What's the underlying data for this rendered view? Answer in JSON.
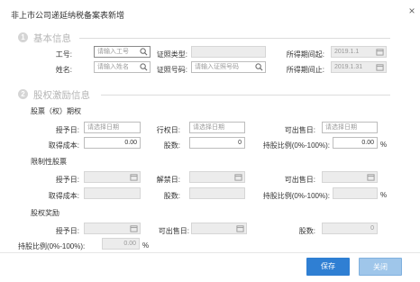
{
  "dialog": {
    "title": "非上市公司递延纳税备案表新增",
    "close_symbol": "×"
  },
  "sections": {
    "basic": {
      "number": "1",
      "title": "基本信息"
    },
    "equity": {
      "number": "2",
      "title": "股权激励信息"
    }
  },
  "basic": {
    "employee_id_label": "工号:",
    "employee_id_placeholder": "请输入工号",
    "cert_type_label": "证照类型:",
    "period_start_label": "所得期间起:",
    "period_start_value": "2019.1.1",
    "name_label": "姓名:",
    "name_placeholder": "请输入姓名",
    "cert_no_label": "证照号码:",
    "cert_no_placeholder": "请输入证照号码",
    "period_end_label": "所得期间止:",
    "period_end_value": "2019.1.31"
  },
  "stock_option": {
    "title": "股票（权）期权",
    "grant_date_label": "授予日:",
    "grant_date_placeholder": "请选择日期",
    "exercise_date_label": "行权日:",
    "exercise_date_placeholder": "请选择日期",
    "sellable_date_label": "可出售日:",
    "sellable_date_placeholder": "请选择日期",
    "cost_label": "取得成本:",
    "cost_value": "0.00",
    "shares_label": "股数:",
    "shares_value": "0",
    "ratio_label": "持股比例(0%-100%):",
    "ratio_value": "0.00",
    "ratio_unit": "%"
  },
  "restricted": {
    "title": "限制性股票",
    "grant_date_label": "授予日:",
    "unlock_date_label": "解禁日:",
    "sellable_date_label": "可出售日:",
    "cost_label": "取得成本:",
    "shares_label": "股数:",
    "ratio_label": "持股比例(0%-100%):",
    "ratio_unit": "%"
  },
  "equity_reward": {
    "title": "股权奖励",
    "grant_date_label": "授予日:",
    "sellable_date_label": "可出售日:",
    "shares_label": "股数:",
    "shares_value": "0",
    "ratio_label": "持股比例(0%-100%):",
    "ratio_value": "0.00",
    "ratio_unit": "%"
  },
  "footer": {
    "save_label": "保存",
    "close_label": "关闭"
  },
  "colors": {
    "primary": "#2f7fd3",
    "disabled_btn": "#9fc6ea",
    "section_gray": "#b5b5b5"
  }
}
